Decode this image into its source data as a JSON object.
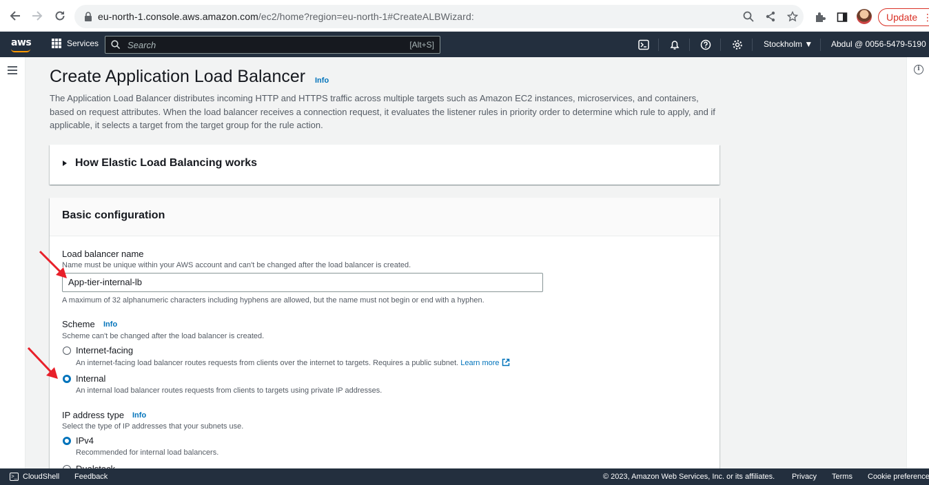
{
  "browser": {
    "url_host": "eu-north-1.console.aws.amazon.com",
    "url_path": "/ec2/home?region=eu-north-1#CreateALBWizard:",
    "update_label": "Update"
  },
  "aws_nav": {
    "logo": "aws",
    "services_label": "Services",
    "search_placeholder": "Search",
    "search_shortcut": "[Alt+S]",
    "region": "Stockholm ▼",
    "account": "Abdul @ 0056-5479-5190 ▼"
  },
  "page": {
    "title": "Create Application Load Balancer",
    "title_info": "Info",
    "description": "The Application Load Balancer distributes incoming HTTP and HTTPS traffic across multiple targets such as Amazon EC2 instances, microservices, and containers, based on request attributes. When the load balancer receives a connection request, it evaluates the listener rules in priority order to determine which rule to apply, and if applicable, it selects a target from the target group for the rule action."
  },
  "how_panel": {
    "title": "How Elastic Load Balancing works"
  },
  "basic": {
    "title": "Basic configuration",
    "name_label": "Load balancer name",
    "name_desc": "Name must be unique within your AWS account and can't be changed after the load balancer is created.",
    "name_value": "App-tier-internal-lb",
    "name_hint": "A maximum of 32 alphanumeric characters including hyphens are allowed, but the name must not begin or end with a hyphen.",
    "scheme_label": "Scheme",
    "scheme_info": "Info",
    "scheme_desc": "Scheme can't be changed after the load balancer is created.",
    "scheme_options": [
      {
        "label": "Internet-facing",
        "desc": "An internet-facing load balancer routes requests from clients over the internet to targets. Requires a public subnet.",
        "link": "Learn more",
        "checked": false
      },
      {
        "label": "Internal",
        "desc": "An internal load balancer routes requests from clients to targets using private IP addresses.",
        "checked": true
      }
    ],
    "ip_label": "IP address type",
    "ip_info": "Info",
    "ip_desc": "Select the type of IP addresses that your subnets use.",
    "ip_options": [
      {
        "label": "IPv4",
        "desc": "Recommended for internal load balancers.",
        "checked": true
      },
      {
        "label": "Dualstack",
        "checked": false
      }
    ]
  },
  "footer": {
    "cloudshell": "CloudShell",
    "feedback": "Feedback",
    "copyright": "© 2023, Amazon Web Services, Inc. or its affiliates.",
    "privacy": "Privacy",
    "terms": "Terms",
    "cookies": "Cookie preferences"
  },
  "colors": {
    "aws_nav": "#232f3e",
    "link": "#0073bb",
    "accent_orange": "#ff9900",
    "annotation_arrow": "#e8202a"
  }
}
